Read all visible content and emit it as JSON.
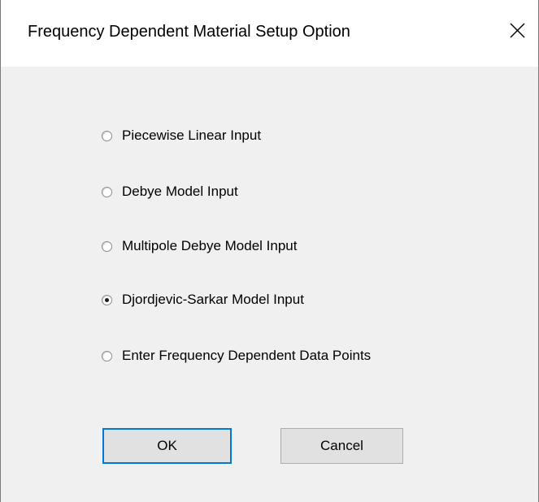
{
  "dialog": {
    "title": "Frequency Dependent Material Setup Option",
    "close_icon": "close-icon"
  },
  "options": [
    {
      "label": "Piecewise Linear Input",
      "selected": false
    },
    {
      "label": "Debye Model Input",
      "selected": false
    },
    {
      "label": "Multipole Debye Model Input",
      "selected": false
    },
    {
      "label": "Djordjevic-Sarkar Model Input",
      "selected": true
    },
    {
      "label": "Enter Frequency Dependent Data Points",
      "selected": false
    }
  ],
  "buttons": {
    "ok_label": "OK",
    "cancel_label": "Cancel"
  },
  "colors": {
    "title_bg": "#ffffff",
    "client_bg": "#f0f0f0",
    "button_bg": "#e1e1e1",
    "default_button_border": "#0078d7"
  }
}
